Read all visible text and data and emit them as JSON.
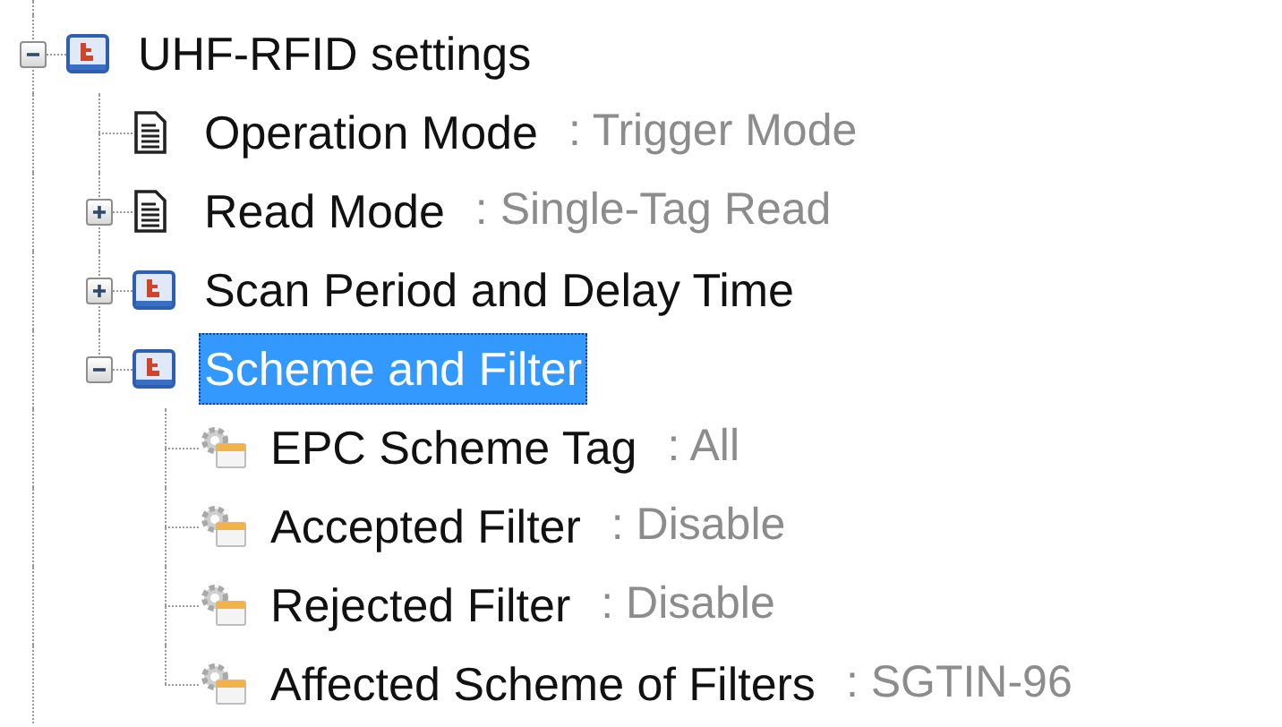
{
  "tree": {
    "label": "UHF-RFID settings",
    "kind": "folder",
    "expanded": true,
    "selected": false,
    "children": [
      {
        "label": "Operation Mode",
        "value": ": Trigger Mode",
        "kind": "document",
        "selected": false
      },
      {
        "label": "Read Mode",
        "value": ": Single-Tag Read",
        "kind": "document",
        "expanded": false,
        "selected": false
      },
      {
        "label": "Scan Period and Delay Time",
        "kind": "folder",
        "expanded": false,
        "selected": false
      },
      {
        "label": "Scheme and Filter",
        "kind": "folder",
        "expanded": true,
        "selected": true,
        "children": [
          {
            "label": "EPC Scheme Tag",
            "value": ": All",
            "kind": "setting",
            "selected": false
          },
          {
            "label": "Accepted Filter",
            "value": ": Disable",
            "kind": "setting",
            "selected": false
          },
          {
            "label": "Rejected Filter",
            "value": ": Disable",
            "kind": "setting",
            "selected": false
          },
          {
            "label": "Affected Scheme of Filters",
            "value": ": SGTIN-96",
            "kind": "setting",
            "selected": false
          }
        ]
      }
    ]
  }
}
